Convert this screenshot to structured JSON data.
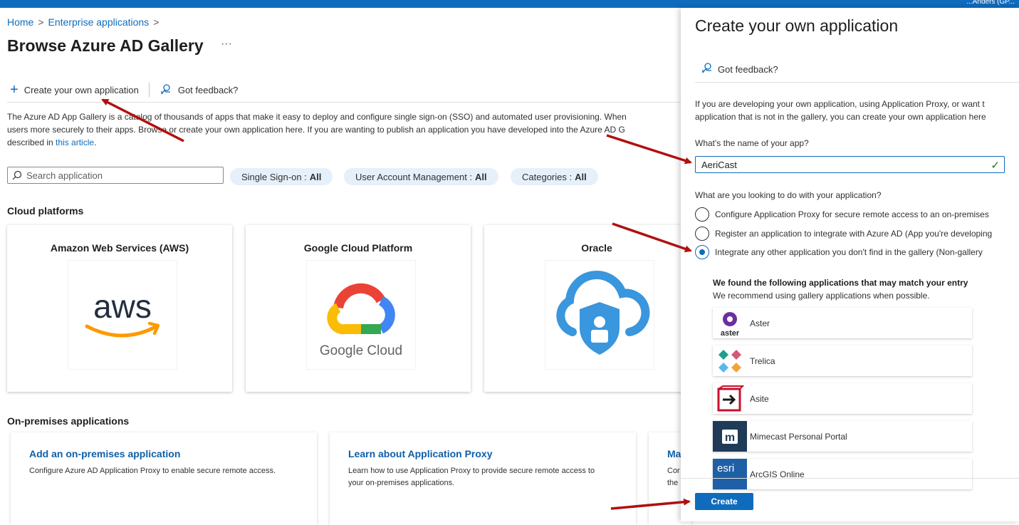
{
  "topbar": {
    "user_text": "...Anders (GP..."
  },
  "breadcrumb": {
    "home": "Home",
    "enterprise": "Enterprise applications",
    "sep": ">"
  },
  "page": {
    "title": "Browse Azure AD Gallery",
    "more": "···",
    "toolbar": {
      "create": "Create your own application",
      "feedback": "Got feedback?"
    },
    "description": {
      "line1": "The Azure AD App Gallery is a catalog of thousands of apps that make it easy to deploy and configure single sign-on (SSO) and automated user provisioning. When",
      "line2": "users more securely to their apps. Browse or create your own application here. If you are wanting to publish an application you have developed into the Azure AD G",
      "line3_prefix": "described in ",
      "link": "this article",
      "line3_suffix": "."
    },
    "search": {
      "placeholder": "Search application",
      "value": ""
    },
    "filters": [
      {
        "label": "Single Sign-on :",
        "value": "All"
      },
      {
        "label": "User Account Management :",
        "value": "All"
      },
      {
        "label": "Categories :",
        "value": "All"
      }
    ],
    "cloud_section": "Cloud platforms",
    "cloud_cards": [
      {
        "title": "Amazon Web Services (AWS)",
        "logo_text": "aws"
      },
      {
        "title": "Google Cloud Platform",
        "logo_text": "Google Cloud"
      },
      {
        "title": "Oracle"
      }
    ],
    "onprem_section": "On-premises applications",
    "onprem_cards": [
      {
        "title": "Add an on-premises application",
        "text": "Configure Azure AD Application Proxy to enable secure remote access."
      },
      {
        "title": "Learn about Application Proxy",
        "text": "Learn how to use Application Proxy to provide secure remote access to your on-premises applications."
      },
      {
        "title": "Ma",
        "text": "Cor the"
      }
    ]
  },
  "panel": {
    "title": "Create your own application",
    "feedback": "Got feedback?",
    "desc_line1": "If you are developing your own application, using Application Proxy, or want t",
    "desc_line2": "application that is not in the gallery, you can create your own application here",
    "name_label": "What's the name of your app?",
    "name_value": "AeriCast",
    "purpose_label": "What are you looking to do with your application?",
    "options": [
      {
        "label": "Configure Application Proxy for secure remote access to an on-premises",
        "checked": false
      },
      {
        "label": "Register an application to integrate with Azure AD (App you're developing",
        "checked": false
      },
      {
        "label": "Integrate any other application you don't find in the gallery (Non-gallery",
        "checked": true
      }
    ],
    "matches_title": "We found the following applications that may match your entry",
    "matches_subtitle": "We recommend using gallery applications when possible.",
    "matches": [
      {
        "name": "Aster",
        "logo": "aster"
      },
      {
        "name": "Trelica"
      },
      {
        "name": "Asite"
      },
      {
        "name": "Mimecast Personal Portal",
        "logo": "m"
      },
      {
        "name": "ArcGIS Online",
        "logo": "esri"
      }
    ],
    "create_button": "Create"
  },
  "colors": {
    "accent": "#0f6cbd",
    "annotation_arrow": "#b01010",
    "success": "#107c10"
  }
}
